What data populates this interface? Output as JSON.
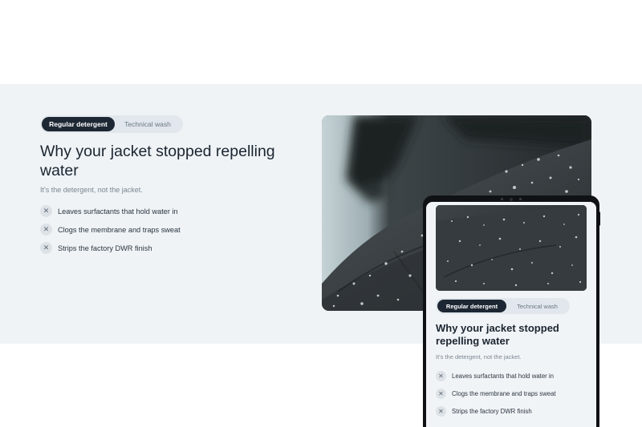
{
  "feature": {
    "toggle": {
      "active_label": "Regular detergent",
      "inactive_label": "Technical wash"
    },
    "headline": "Why your jacket stopped repelling water",
    "subline": "It's the detergent, not the jacket.",
    "bullets": [
      "Leaves surfactants that hold water in",
      "Clogs the membrane and traps sweat",
      "Strips the factory DWR finish"
    ],
    "bullet_icon": "x-icon",
    "photo_subject": "water-beaded-jacket-photo"
  },
  "colors": {
    "band_background": "#eff3f6",
    "toggle_active": "#1d2733",
    "toggle_track": "#e1e7ec",
    "headline": "#1b2530",
    "tablet_frame": "#0f1114"
  }
}
